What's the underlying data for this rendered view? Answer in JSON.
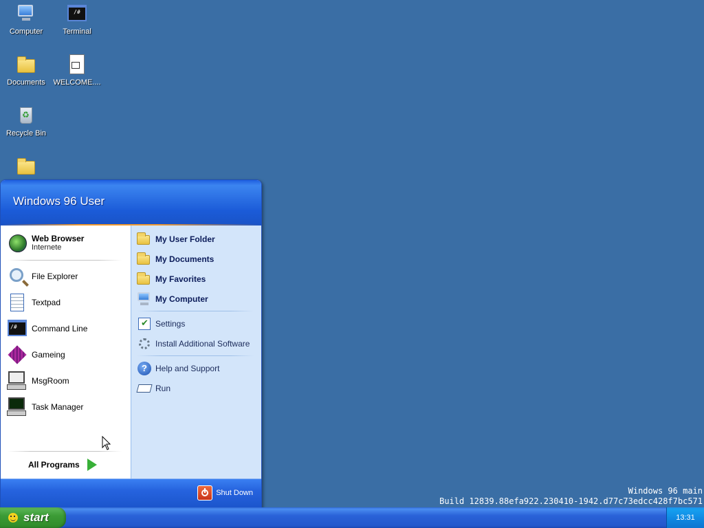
{
  "desktop": {
    "icons": [
      {
        "label": "Computer"
      },
      {
        "label": "Terminal"
      },
      {
        "label": "Documents"
      },
      {
        "label": "WELCOME...."
      },
      {
        "label": "Recycle Bin"
      },
      {
        "label": ""
      }
    ],
    "terminal_glyph": "/#",
    "doc_glyph": "M↓"
  },
  "start_menu": {
    "user_name": "Windows 96 User",
    "pinned": {
      "title": "Web Browser",
      "subtitle": "Internete"
    },
    "left_items": [
      {
        "label": "File Explorer"
      },
      {
        "label": "Textpad"
      },
      {
        "label": "Command Line"
      },
      {
        "label": "Gameing"
      },
      {
        "label": "MsgRoom"
      },
      {
        "label": "Task Manager"
      }
    ],
    "all_programs": "All Programs",
    "right_items": [
      {
        "label": "My User Folder"
      },
      {
        "label": "My Documents"
      },
      {
        "label": "My Favorites"
      },
      {
        "label": "My Computer"
      },
      {
        "label": "Settings"
      },
      {
        "label": "Install Additional Software"
      },
      {
        "label": "Help and Support"
      },
      {
        "label": "Run"
      }
    ],
    "shutdown": "Shut Down",
    "help_glyph": "?"
  },
  "taskbar": {
    "start_label": "start",
    "clock": "13:31"
  },
  "build_info": {
    "line1": "Windows 96 main",
    "line2": "Build 12839.88efa922.230410-1942.d77c73edcc428f7bc571"
  },
  "colors": {
    "desktop": "#3a6ea5",
    "start_green": "#3c9c36",
    "menu_blue": "#1b5bd8",
    "menu_right_panel": "#d3e5fa"
  }
}
